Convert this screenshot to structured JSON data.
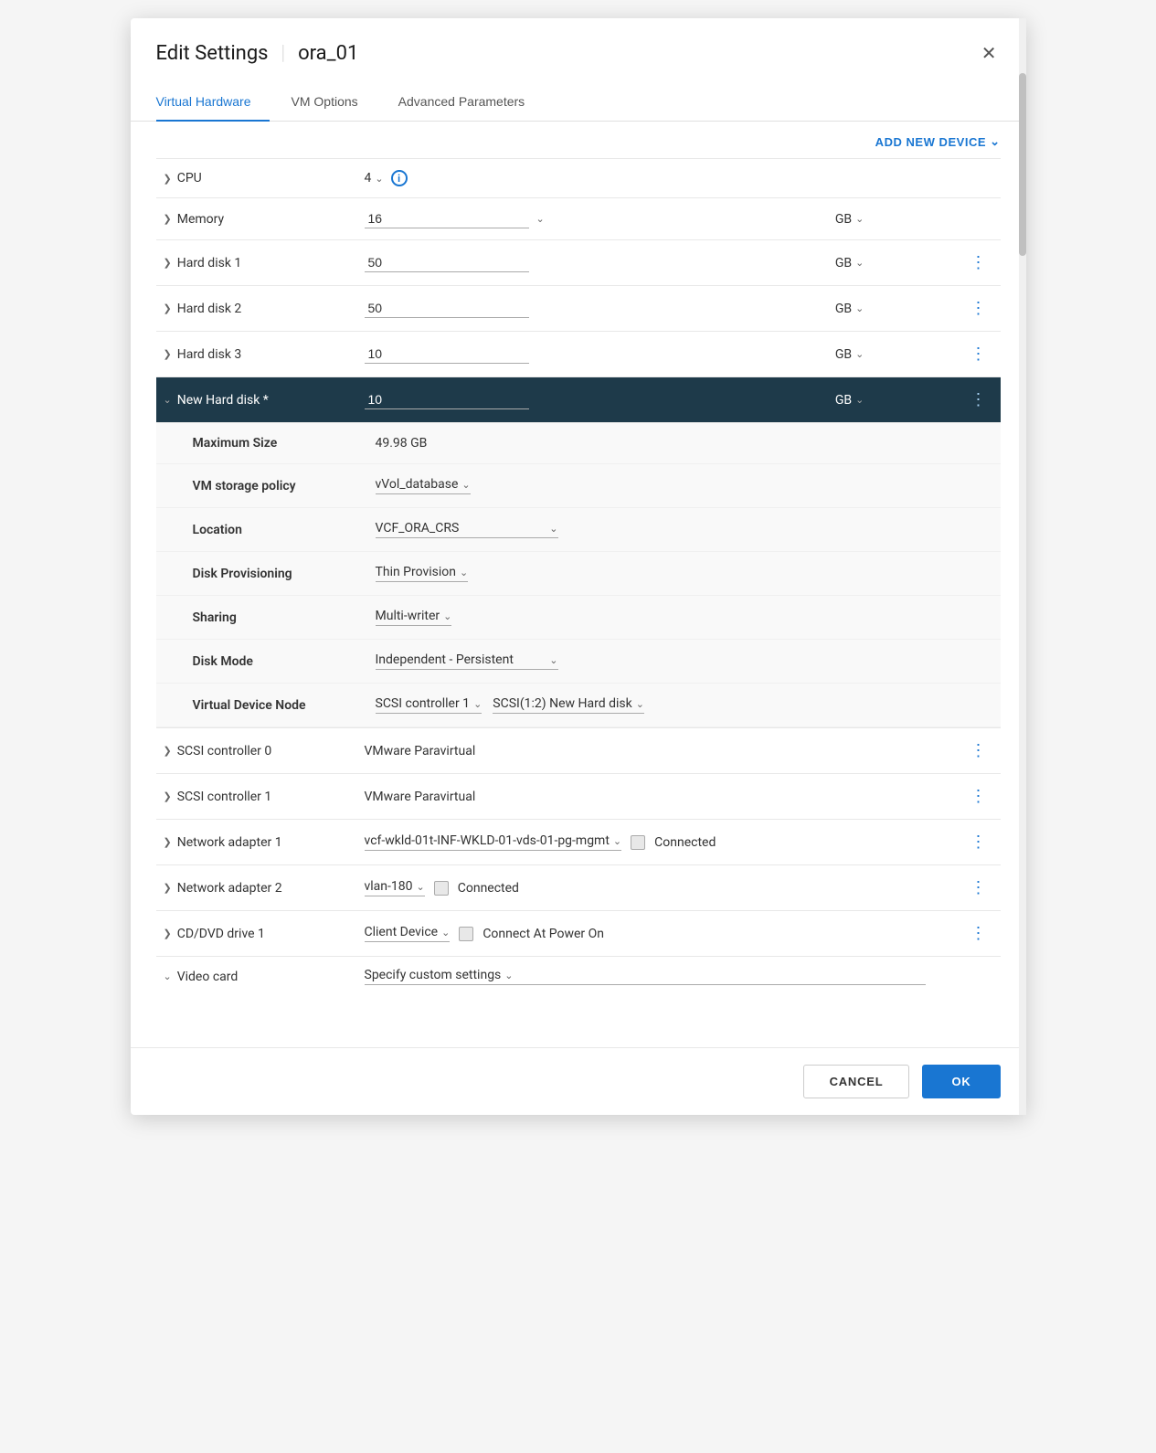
{
  "modal": {
    "title": "Edit Settings",
    "subtitle": "ora_01",
    "close_label": "×"
  },
  "tabs": [
    {
      "id": "virtual-hardware",
      "label": "Virtual Hardware",
      "active": true
    },
    {
      "id": "vm-options",
      "label": "VM Options",
      "active": false
    },
    {
      "id": "advanced-parameters",
      "label": "Advanced Parameters",
      "active": false
    }
  ],
  "add_device_btn": "ADD NEW DEVICE",
  "hardware_rows": [
    {
      "id": "cpu",
      "label": "CPU",
      "value": "4",
      "unit": "",
      "has_info": true,
      "has_dots": false,
      "expanded": false
    },
    {
      "id": "memory",
      "label": "Memory",
      "value": "16",
      "unit": "GB",
      "has_info": false,
      "has_dots": false,
      "expanded": false
    },
    {
      "id": "hard-disk-1",
      "label": "Hard disk 1",
      "value": "50",
      "unit": "GB",
      "has_info": false,
      "has_dots": true,
      "expanded": false
    },
    {
      "id": "hard-disk-2",
      "label": "Hard disk 2",
      "value": "50",
      "unit": "GB",
      "has_info": false,
      "has_dots": true,
      "expanded": false
    },
    {
      "id": "hard-disk-3",
      "label": "Hard disk 3",
      "value": "10",
      "unit": "GB",
      "has_info": false,
      "has_dots": true,
      "expanded": false
    },
    {
      "id": "new-hard-disk",
      "label": "New Hard disk *",
      "value": "10",
      "unit": "GB",
      "has_info": false,
      "has_dots": true,
      "expanded": true
    }
  ],
  "expanded_disk": {
    "max_size_label": "Maximum Size",
    "max_size_value": "49.98 GB",
    "storage_policy_label": "VM storage policy",
    "storage_policy_value": "vVol_database",
    "location_label": "Location",
    "location_value": "VCF_ORA_CRS",
    "disk_provisioning_label": "Disk Provisioning",
    "disk_provisioning_value": "Thin Provision",
    "sharing_label": "Sharing",
    "sharing_value": "Multi-writer",
    "disk_mode_label": "Disk Mode",
    "disk_mode_value": "Independent - Persistent",
    "vdn_label": "Virtual Device Node",
    "vdn_controller": "SCSI controller 1",
    "vdn_disk": "SCSI(1:2) New Hard disk"
  },
  "other_rows": [
    {
      "id": "scsi-0",
      "label": "SCSI controller 0",
      "value": "VMware Paravirtual",
      "has_dots": true
    },
    {
      "id": "scsi-1",
      "label": "SCSI controller 1",
      "value": "VMware Paravirtual",
      "has_dots": true
    },
    {
      "id": "net-adapter-1",
      "label": "Network adapter 1",
      "value": "vcf-wkld-01t-INF-WKLD-01-vds-01-pg-mgmt",
      "connected": true,
      "has_dots": true
    },
    {
      "id": "net-adapter-2",
      "label": "Network adapter 2",
      "value": "vlan-180",
      "connected": true,
      "has_dots": true
    },
    {
      "id": "cd-dvd",
      "label": "CD/DVD drive 1",
      "value": "Client Device",
      "connect_power": "Connect At Power On",
      "has_dots": true
    },
    {
      "id": "video-card",
      "label": "Video card",
      "value": "Specify custom settings",
      "has_dots": false
    }
  ],
  "footer": {
    "cancel_label": "CANCEL",
    "ok_label": "OK"
  }
}
